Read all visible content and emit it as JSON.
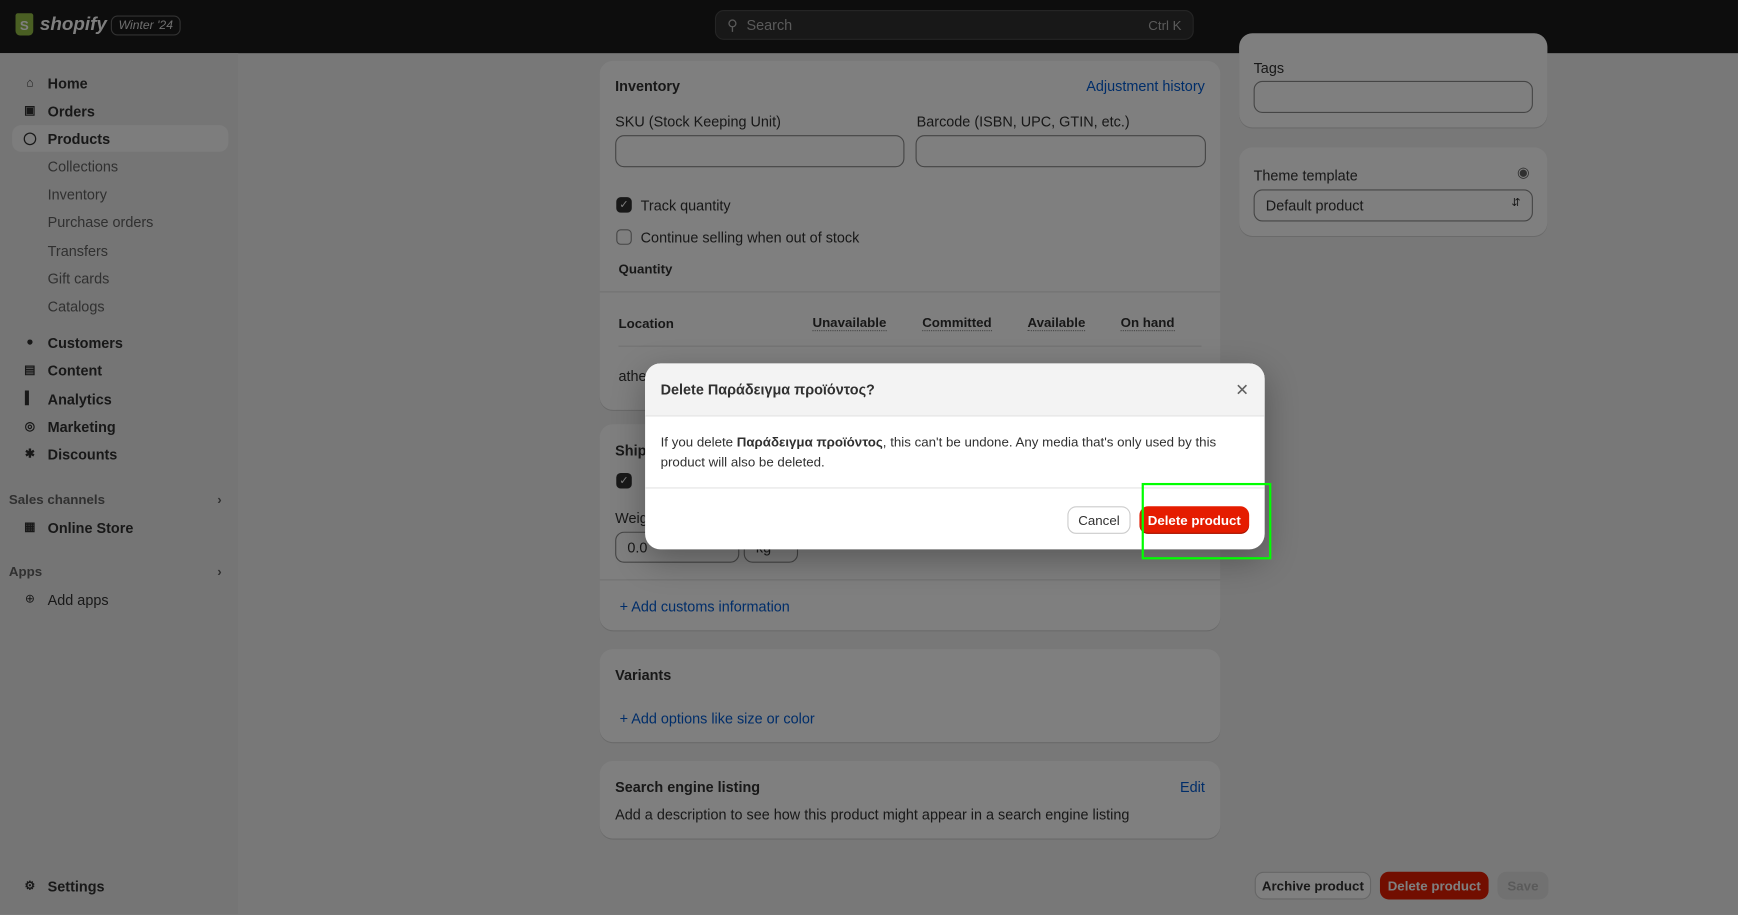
{
  "topbar": {
    "brand": "shopify",
    "version_badge": "Winter '24",
    "search_placeholder": "Search",
    "search_shortcut": "Ctrl K"
  },
  "sidebar": {
    "items": [
      {
        "label": "Home",
        "icon": "home-icon"
      },
      {
        "label": "Orders",
        "icon": "inbox-icon"
      },
      {
        "label": "Products",
        "icon": "tag-icon",
        "active": true
      }
    ],
    "product_sub": [
      "Collections",
      "Inventory",
      "Purchase orders",
      "Transfers",
      "Gift cards",
      "Catalogs"
    ],
    "items2": [
      {
        "label": "Customers",
        "icon": "person-icon"
      },
      {
        "label": "Content",
        "icon": "content-icon"
      },
      {
        "label": "Analytics",
        "icon": "bar-chart-icon"
      },
      {
        "label": "Marketing",
        "icon": "target-icon"
      },
      {
        "label": "Discounts",
        "icon": "discount-icon"
      }
    ],
    "sales_channels": "Sales channels",
    "online_store": "Online Store",
    "apps": "Apps",
    "add_apps": "Add apps",
    "settings": "Settings"
  },
  "inventory": {
    "title": "Inventory",
    "history_link": "Adjustment history",
    "sku_label": "SKU (Stock Keeping Unit)",
    "barcode_label": "Barcode (ISBN, UPC, GTIN, etc.)",
    "track_quantity": "Track quantity",
    "continue_selling": "Continue selling when out of stock",
    "quantity": "Quantity",
    "columns": [
      "Location",
      "Unavailable",
      "Committed",
      "Available",
      "On hand"
    ],
    "location_partial": "athe"
  },
  "shipping": {
    "title_partial": "Ship",
    "weight_partial": "Weig",
    "weight_value": "0.0",
    "unit_partial": "kg",
    "customs_link": "Add customs information"
  },
  "variants": {
    "title": "Variants",
    "add_link": "Add options like size or color"
  },
  "seo": {
    "title": "Search engine listing",
    "edit": "Edit",
    "description": "Add a description to see how this product might appear in a search engine listing"
  },
  "right": {
    "tags_label": "Tags",
    "theme_label": "Theme template",
    "theme_value": "Default product"
  },
  "footer": {
    "archive": "Archive product",
    "delete": "Delete product",
    "save": "Save"
  },
  "modal": {
    "title": "Delete Παράδειγμα προϊόντος?",
    "body_pre": "If you delete ",
    "body_bold": "Παράδειγμα προϊόντος",
    "body_post": ", this can't be undone. Any media that's only used by this product will also be deleted.",
    "cancel": "Cancel",
    "confirm": "Delete product"
  },
  "colors": {
    "critical": "#e51c00",
    "highlight": "#00ff00",
    "link": "#005bd3"
  }
}
